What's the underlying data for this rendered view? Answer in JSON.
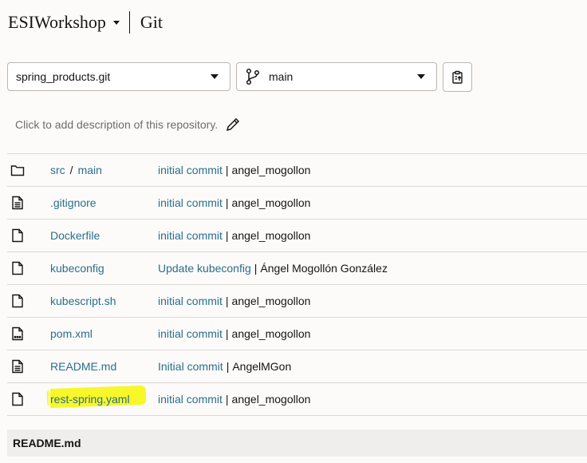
{
  "header": {
    "project": "ESIWorkshop",
    "section": "Git"
  },
  "repo_select": {
    "value": "spring_products.git"
  },
  "branch_select": {
    "value": "main"
  },
  "description": {
    "placeholder": "Click to add description of this repository."
  },
  "files": [
    {
      "icon": "folder-icon",
      "name": "src",
      "sub": "main",
      "commit": "initial commit",
      "author": "angel_mogollon"
    },
    {
      "icon": "text-file-icon",
      "name": ".gitignore",
      "commit": "initial commit",
      "author": "angel_mogollon"
    },
    {
      "icon": "file-icon",
      "name": "Dockerfile",
      "commit": "initial commit",
      "author": "angel_mogollon"
    },
    {
      "icon": "file-icon",
      "name": "kubeconfig",
      "commit": "Update kubeconfig",
      "author": "Ángel Mogollón González"
    },
    {
      "icon": "file-icon",
      "name": "kubescript.sh",
      "commit": "initial commit",
      "author": "angel_mogollon"
    },
    {
      "icon": "code-file-icon",
      "name": "pom.xml",
      "commit": "initial commit",
      "author": "angel_mogollon"
    },
    {
      "icon": "text-file-icon",
      "name": "README.md",
      "commit": "Initial commit",
      "author": "AngelMGon"
    },
    {
      "icon": "file-icon",
      "name": "rest-spring.yaml",
      "commit": "initial commit",
      "author": "angel_mogollon",
      "highlight_color": "#f7f72a"
    }
  ],
  "commit_separator": "|",
  "path_separator": "/",
  "readme": {
    "title": "README.md"
  },
  "colors": {
    "link": "#2a6f8a",
    "highlight": "#f7f72a",
    "background": "#fcfbfa"
  }
}
